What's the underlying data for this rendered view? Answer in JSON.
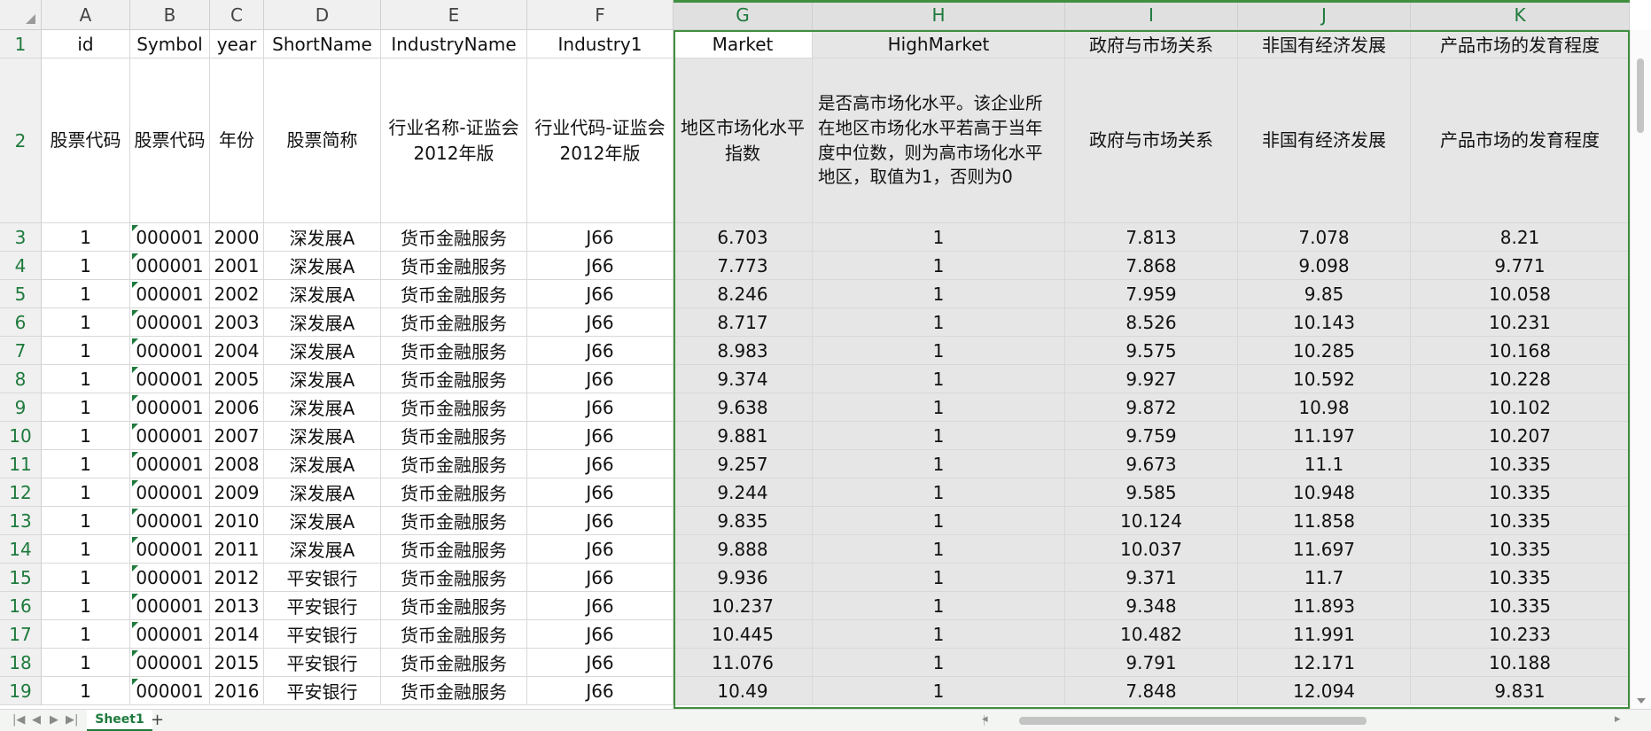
{
  "columns": [
    "A",
    "B",
    "C",
    "D",
    "E",
    "F",
    "G",
    "H",
    "I",
    "J",
    "K"
  ],
  "row_numbers": [
    "1",
    "2",
    "3",
    "4",
    "5",
    "6",
    "7",
    "8",
    "9",
    "10",
    "11",
    "12",
    "13",
    "14",
    "15",
    "16",
    "17",
    "18",
    "19"
  ],
  "header_row": [
    "id",
    "Symbol",
    "year",
    "ShortName",
    "IndustryName",
    "Industry1",
    "Market",
    "HighMarket",
    "政府与市场关系",
    "非国有经济发展",
    "产品市场的发育程度"
  ],
  "desc_row": [
    "股票代码",
    "股票代码",
    "年份",
    "股票简称",
    "行业名称-证监会2012年版",
    "行业代码-证监会2012年版",
    "地区市场化水平指数",
    "是否高市场化水平。该企业所在地区市场化水平若高于当年度中位数，则为高市场化水平地区，取值为1，否则为0",
    "政府与市场关系",
    "非国有经济发展",
    "产品市场的发育程度"
  ],
  "rows": [
    [
      "1",
      "000001",
      "2000",
      "深发展A",
      "货币金融服务",
      "J66",
      "6.703",
      "1",
      "7.813",
      "7.078",
      "8.21"
    ],
    [
      "1",
      "000001",
      "2001",
      "深发展A",
      "货币金融服务",
      "J66",
      "7.773",
      "1",
      "7.868",
      "9.098",
      "9.771"
    ],
    [
      "1",
      "000001",
      "2002",
      "深发展A",
      "货币金融服务",
      "J66",
      "8.246",
      "1",
      "7.959",
      "9.85",
      "10.058"
    ],
    [
      "1",
      "000001",
      "2003",
      "深发展A",
      "货币金融服务",
      "J66",
      "8.717",
      "1",
      "8.526",
      "10.143",
      "10.231"
    ],
    [
      "1",
      "000001",
      "2004",
      "深发展A",
      "货币金融服务",
      "J66",
      "8.983",
      "1",
      "9.575",
      "10.285",
      "10.168"
    ],
    [
      "1",
      "000001",
      "2005",
      "深发展A",
      "货币金融服务",
      "J66",
      "9.374",
      "1",
      "9.927",
      "10.592",
      "10.228"
    ],
    [
      "1",
      "000001",
      "2006",
      "深发展A",
      "货币金融服务",
      "J66",
      "9.638",
      "1",
      "9.872",
      "10.98",
      "10.102"
    ],
    [
      "1",
      "000001",
      "2007",
      "深发展A",
      "货币金融服务",
      "J66",
      "9.881",
      "1",
      "9.759",
      "11.197",
      "10.207"
    ],
    [
      "1",
      "000001",
      "2008",
      "深发展A",
      "货币金融服务",
      "J66",
      "9.257",
      "1",
      "9.673",
      "11.1",
      "10.335"
    ],
    [
      "1",
      "000001",
      "2009",
      "深发展A",
      "货币金融服务",
      "J66",
      "9.244",
      "1",
      "9.585",
      "10.948",
      "10.335"
    ],
    [
      "1",
      "000001",
      "2010",
      "深发展A",
      "货币金融服务",
      "J66",
      "9.835",
      "1",
      "10.124",
      "11.858",
      "10.335"
    ],
    [
      "1",
      "000001",
      "2011",
      "深发展A",
      "货币金融服务",
      "J66",
      "9.888",
      "1",
      "10.037",
      "11.697",
      "10.335"
    ],
    [
      "1",
      "000001",
      "2012",
      "平安银行",
      "货币金融服务",
      "J66",
      "9.936",
      "1",
      "9.371",
      "11.7",
      "10.335"
    ],
    [
      "1",
      "000001",
      "2013",
      "平安银行",
      "货币金融服务",
      "J66",
      "10.237",
      "1",
      "9.348",
      "11.893",
      "10.335"
    ],
    [
      "1",
      "000001",
      "2014",
      "平安银行",
      "货币金融服务",
      "J66",
      "10.445",
      "1",
      "10.482",
      "11.991",
      "10.233"
    ],
    [
      "1",
      "000001",
      "2015",
      "平安银行",
      "货币金融服务",
      "J66",
      "11.076",
      "1",
      "9.791",
      "12.171",
      "10.188"
    ],
    [
      "1",
      "000001",
      "2016",
      "平安银行",
      "货币金融服务",
      "J66",
      "10.49",
      "1",
      "7.848",
      "12.094",
      "9.831"
    ]
  ],
  "sheet_tab": "Sheet1",
  "add_sheet": "+"
}
